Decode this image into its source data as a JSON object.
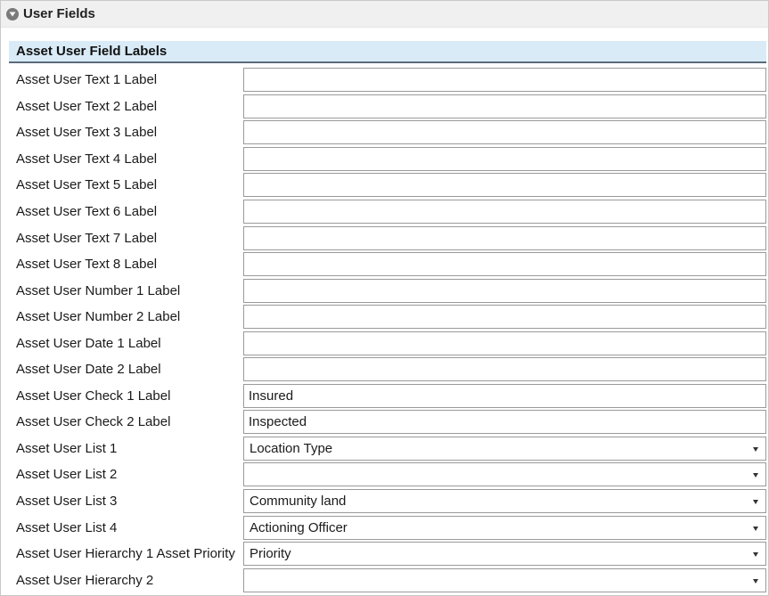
{
  "panel": {
    "title": "User Fields",
    "collapse_icon": "chevron-down-circle-icon"
  },
  "section": {
    "title": "Asset User Field Labels"
  },
  "colors": {
    "section_header_bg": "#d9ebf7",
    "section_header_border": "#5b6b7a",
    "panel_header_bg": "#f0f0f0"
  },
  "fields": [
    {
      "label": "Asset User Text 1 Label",
      "type": "text",
      "value": ""
    },
    {
      "label": "Asset User Text 2 Label",
      "type": "text",
      "value": ""
    },
    {
      "label": "Asset User Text 3 Label",
      "type": "text",
      "value": ""
    },
    {
      "label": "Asset User Text 4 Label",
      "type": "text",
      "value": ""
    },
    {
      "label": "Asset User Text 5 Label",
      "type": "text",
      "value": ""
    },
    {
      "label": "Asset User Text 6 Label",
      "type": "text",
      "value": ""
    },
    {
      "label": "Asset User Text 7 Label",
      "type": "text",
      "value": ""
    },
    {
      "label": "Asset User Text 8 Label",
      "type": "text",
      "value": ""
    },
    {
      "label": "Asset User Number 1 Label",
      "type": "text",
      "value": ""
    },
    {
      "label": "Asset User Number 2 Label",
      "type": "text",
      "value": ""
    },
    {
      "label": "Asset User Date 1 Label",
      "type": "text",
      "value": ""
    },
    {
      "label": "Asset User Date 2 Label",
      "type": "text",
      "value": ""
    },
    {
      "label": "Asset User Check 1 Label",
      "type": "text",
      "value": "Insured"
    },
    {
      "label": "Asset User Check 2 Label",
      "type": "text",
      "value": "Inspected"
    },
    {
      "label": "Asset User List 1",
      "type": "select",
      "value": "Location Type"
    },
    {
      "label": "Asset User List 2",
      "type": "select",
      "value": ""
    },
    {
      "label": "Asset User List 3",
      "type": "select",
      "value": "Community land"
    },
    {
      "label": "Asset User List 4",
      "type": "select",
      "value": "Actioning Officer"
    },
    {
      "label": "Asset User Hierarchy 1 Asset Priority",
      "type": "select",
      "value": "Priority"
    },
    {
      "label": "Asset User Hierarchy 2",
      "type": "select",
      "value": ""
    }
  ]
}
